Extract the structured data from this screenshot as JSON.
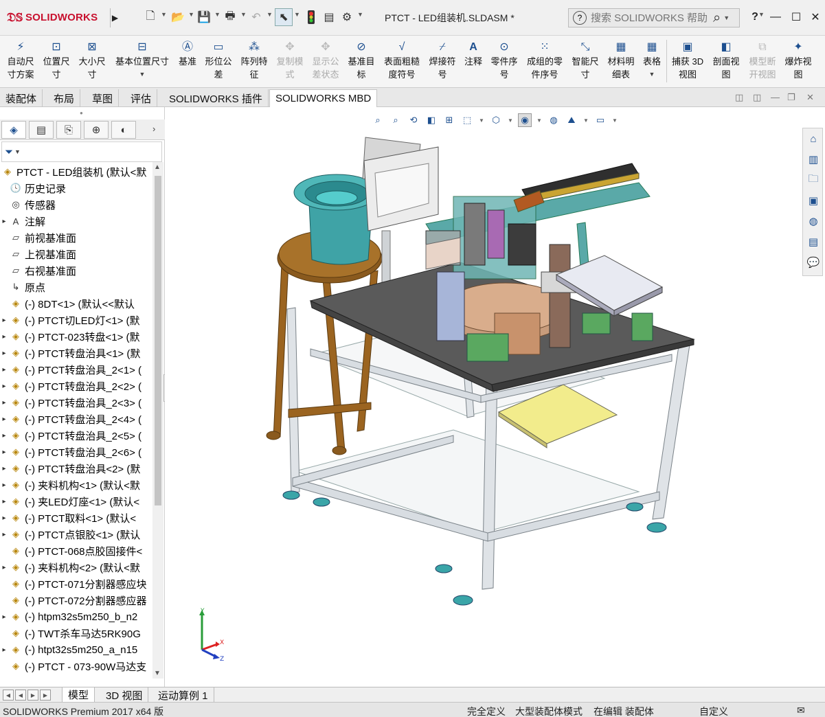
{
  "app": {
    "brand": "SOLIDWORKS",
    "document_title": "PTCT - LED组装机.SLDASM *",
    "search_placeholder": "搜索 SOLIDWORKS 帮助",
    "help_label": "?"
  },
  "ribbon": {
    "buttons": [
      {
        "label": "自动尺寸方案",
        "icon": "auto-dim-icon",
        "enabled": true
      },
      {
        "label": "位置尺寸",
        "icon": "location-dim-icon",
        "enabled": true
      },
      {
        "label": "大小尺寸",
        "icon": "size-dim-icon",
        "enabled": true
      },
      {
        "label": "基本位置尺寸",
        "icon": "basic-location-dim-icon",
        "enabled": true
      },
      {
        "label": "基准",
        "icon": "datum-icon",
        "enabled": true
      },
      {
        "label": "形位公差",
        "icon": "gtol-icon",
        "enabled": true
      },
      {
        "label": "阵列特征",
        "icon": "pattern-feature-icon",
        "enabled": true
      },
      {
        "label": "复制模式",
        "icon": "copy-scheme-icon",
        "enabled": false
      },
      {
        "label": "显示公差状态",
        "icon": "tolerance-status-icon",
        "enabled": false
      },
      {
        "label": "基准目标",
        "icon": "datum-target-icon",
        "enabled": true
      },
      {
        "label": "表面粗糙度符号",
        "icon": "surface-finish-icon",
        "enabled": true
      },
      {
        "label": "焊接符号",
        "icon": "weld-symbol-icon",
        "enabled": true
      },
      {
        "label": "注释",
        "icon": "note-icon",
        "enabled": true
      },
      {
        "label": "零件序号",
        "icon": "balloon-icon",
        "enabled": true
      },
      {
        "label": "成组的零件序号",
        "icon": "stacked-balloon-icon",
        "enabled": true
      },
      {
        "label": "智能尺寸",
        "icon": "smart-dimension-icon",
        "enabled": true
      },
      {
        "label": "材料明细表",
        "icon": "bom-icon",
        "enabled": true
      },
      {
        "label": "表格",
        "icon": "table-icon",
        "enabled": true
      },
      {
        "label": "捕获 3D 视图",
        "icon": "capture-3d-view-icon",
        "enabled": true
      },
      {
        "label": "剖面视图",
        "icon": "section-view-icon",
        "enabled": true
      },
      {
        "label": "模型断开视图",
        "icon": "model-break-view-icon",
        "enabled": false
      },
      {
        "label": "爆炸视图",
        "icon": "explode-view-icon",
        "enabled": true
      }
    ]
  },
  "tabs": [
    "装配体",
    "布局",
    "草图",
    "评估",
    "SOLIDWORKS 插件",
    "SOLIDWORKS MBD"
  ],
  "active_tab": "SOLIDWORKS MBD",
  "tree": {
    "root": "PTCT - LED组装机 (默认<默",
    "items": [
      {
        "label": "历史记录",
        "icon": "history-icon",
        "expandable": false
      },
      {
        "label": "传感器",
        "icon": "sensor-icon",
        "expandable": false
      },
      {
        "label": "注解",
        "icon": "annotations-icon",
        "expandable": true
      },
      {
        "label": "前视基准面",
        "icon": "plane-icon",
        "expandable": false
      },
      {
        "label": "上视基准面",
        "icon": "plane-icon",
        "expandable": false
      },
      {
        "label": "右视基准面",
        "icon": "plane-icon",
        "expandable": false
      },
      {
        "label": "原点",
        "icon": "origin-icon",
        "expandable": false
      },
      {
        "label": "(-) 8DT<1> (默认<<默认",
        "icon": "part-icon",
        "expandable": false
      },
      {
        "label": "(-) PTCT切LED灯<1> (默",
        "icon": "assembly-icon",
        "expandable": true
      },
      {
        "label": "(-) PTCT-023转盘<1> (默",
        "icon": "assembly-icon",
        "expandable": true
      },
      {
        "label": "(-) PTCT转盘治具<1> (默",
        "icon": "assembly-icon",
        "expandable": true
      },
      {
        "label": "(-) PTCT转盘治具_2<1> (",
        "icon": "assembly-icon",
        "expandable": true
      },
      {
        "label": "(-) PTCT转盘治具_2<2> (",
        "icon": "assembly-icon",
        "expandable": true
      },
      {
        "label": "(-) PTCT转盘治具_2<3> (",
        "icon": "assembly-icon",
        "expandable": true
      },
      {
        "label": "(-) PTCT转盘治具_2<4> (",
        "icon": "assembly-icon",
        "expandable": true
      },
      {
        "label": "(-) PTCT转盘治具_2<5> (",
        "icon": "assembly-icon",
        "expandable": true
      },
      {
        "label": "(-) PTCT转盘治具_2<6> (",
        "icon": "assembly-icon",
        "expandable": true
      },
      {
        "label": "(-) PTCT转盘治具<2> (默",
        "icon": "assembly-icon",
        "expandable": true
      },
      {
        "label": "(-) 夹料机构<1> (默认<默",
        "icon": "assembly-icon",
        "expandable": true
      },
      {
        "label": "(-) 夹LED灯座<1> (默认<",
        "icon": "assembly-icon",
        "expandable": true
      },
      {
        "label": "(-) PTCT取料<1> (默认<",
        "icon": "assembly-icon",
        "expandable": true
      },
      {
        "label": "(-) PTCT点银胶<1> (默认",
        "icon": "assembly-icon",
        "expandable": true
      },
      {
        "label": "(-) PTCT-068点胶固接件<",
        "icon": "part-icon",
        "expandable": false
      },
      {
        "label": "(-) 夹料机构<2> (默认<默",
        "icon": "assembly-icon",
        "expandable": true
      },
      {
        "label": "(-) PTCT-071分割器感应块",
        "icon": "part-icon",
        "expandable": false
      },
      {
        "label": "(-) PTCT-072分割器感应器",
        "icon": "part-icon",
        "expandable": false
      },
      {
        "label": "(-) htpm32s5m250_b_n2",
        "icon": "assembly-icon",
        "expandable": true
      },
      {
        "label": "(-) TWT杀车马达5RK90G",
        "icon": "part-icon",
        "expandable": false
      },
      {
        "label": "(-) htpt32s5m250_a_n15",
        "icon": "assembly-icon",
        "expandable": true
      },
      {
        "label": "(-) PTCT - 073-90W马达支",
        "icon": "part-icon",
        "expandable": false
      }
    ]
  },
  "bottom_tabs": [
    "模型",
    "3D 视图",
    "运动算例 1"
  ],
  "active_bottom_tab": "模型",
  "status": {
    "product": "SOLIDWORKS Premium 2017 x64 版",
    "definition": "完全定义",
    "mode": "大型装配体模式",
    "editing": "在编辑 装配体",
    "custom": "自定义"
  },
  "triad_axes": {
    "x": "X",
    "y": "Y",
    "z": "Z"
  },
  "colors": {
    "accent": "#1d4f8f",
    "brand_red": "#c8102e",
    "table_top": "#5a5a5a",
    "frame": "#d8dce0",
    "teal": "#3fa3a6",
    "wood": "#8a5a1e",
    "yellow_tray": "#f2ec8c"
  }
}
